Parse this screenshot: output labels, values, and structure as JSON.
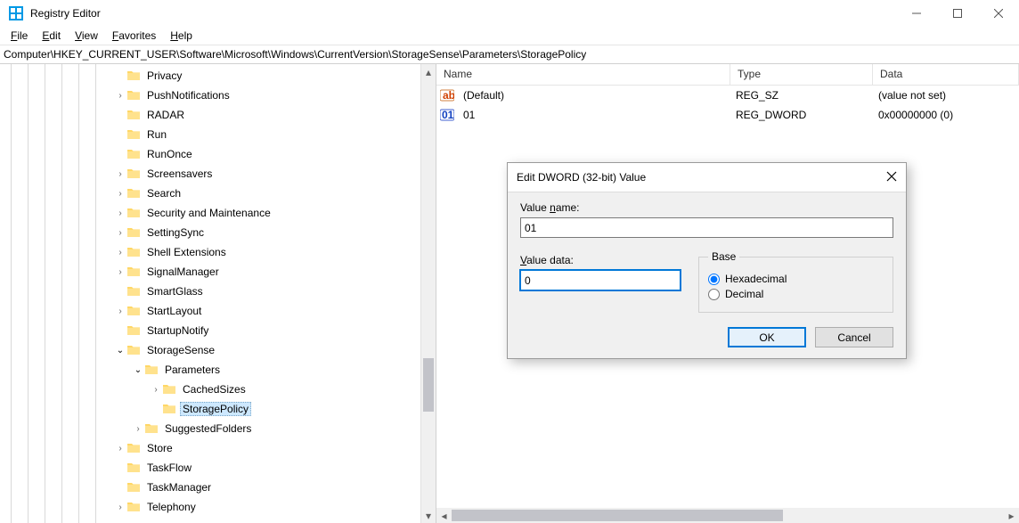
{
  "window": {
    "title": "Registry Editor"
  },
  "menu": {
    "file": "File",
    "edit": "Edit",
    "view": "View",
    "favorites": "Favorites",
    "help": "Help"
  },
  "address": "Computer\\HKEY_CURRENT_USER\\Software\\Microsoft\\Windows\\CurrentVersion\\StorageSense\\Parameters\\StoragePolicy",
  "tree": {
    "items": [
      {
        "label": "Privacy",
        "indent": 0,
        "expander": ""
      },
      {
        "label": "PushNotifications",
        "indent": 0,
        "expander": ">"
      },
      {
        "label": "RADAR",
        "indent": 0,
        "expander": ""
      },
      {
        "label": "Run",
        "indent": 0,
        "expander": ""
      },
      {
        "label": "RunOnce",
        "indent": 0,
        "expander": ""
      },
      {
        "label": "Screensavers",
        "indent": 0,
        "expander": ">"
      },
      {
        "label": "Search",
        "indent": 0,
        "expander": ">"
      },
      {
        "label": "Security and Maintenance",
        "indent": 0,
        "expander": ">"
      },
      {
        "label": "SettingSync",
        "indent": 0,
        "expander": ">"
      },
      {
        "label": "Shell Extensions",
        "indent": 0,
        "expander": ">"
      },
      {
        "label": "SignalManager",
        "indent": 0,
        "expander": ">"
      },
      {
        "label": "SmartGlass",
        "indent": 0,
        "expander": ""
      },
      {
        "label": "StartLayout",
        "indent": 0,
        "expander": ">"
      },
      {
        "label": "StartupNotify",
        "indent": 0,
        "expander": ""
      },
      {
        "label": "StorageSense",
        "indent": 0,
        "expander": "v"
      },
      {
        "label": "Parameters",
        "indent": 1,
        "expander": "v"
      },
      {
        "label": "CachedSizes",
        "indent": 2,
        "expander": ">"
      },
      {
        "label": "StoragePolicy",
        "indent": 2,
        "expander": "",
        "selected": true
      },
      {
        "label": "SuggestedFolders",
        "indent": 1,
        "expander": ">"
      },
      {
        "label": "Store",
        "indent": 0,
        "expander": ">"
      },
      {
        "label": "TaskFlow",
        "indent": 0,
        "expander": ""
      },
      {
        "label": "TaskManager",
        "indent": 0,
        "expander": ""
      },
      {
        "label": "Telephony",
        "indent": 0,
        "expander": ">"
      }
    ]
  },
  "list": {
    "headers": {
      "name": "Name",
      "type": "Type",
      "data": "Data"
    },
    "rows": [
      {
        "name": "(Default)",
        "type": "REG_SZ",
        "data": "(value not set)",
        "icon": "string"
      },
      {
        "name": "01",
        "type": "REG_DWORD",
        "data": "0x00000000 (0)",
        "icon": "dword"
      }
    ]
  },
  "dialog": {
    "title": "Edit DWORD (32-bit) Value",
    "value_name_label": "Value name:",
    "value_name": "01",
    "value_data_label": "Value data:",
    "value_data": "0",
    "base_label": "Base",
    "hex_label": "Hexadecimal",
    "dec_label": "Decimal",
    "ok": "OK",
    "cancel": "Cancel"
  }
}
